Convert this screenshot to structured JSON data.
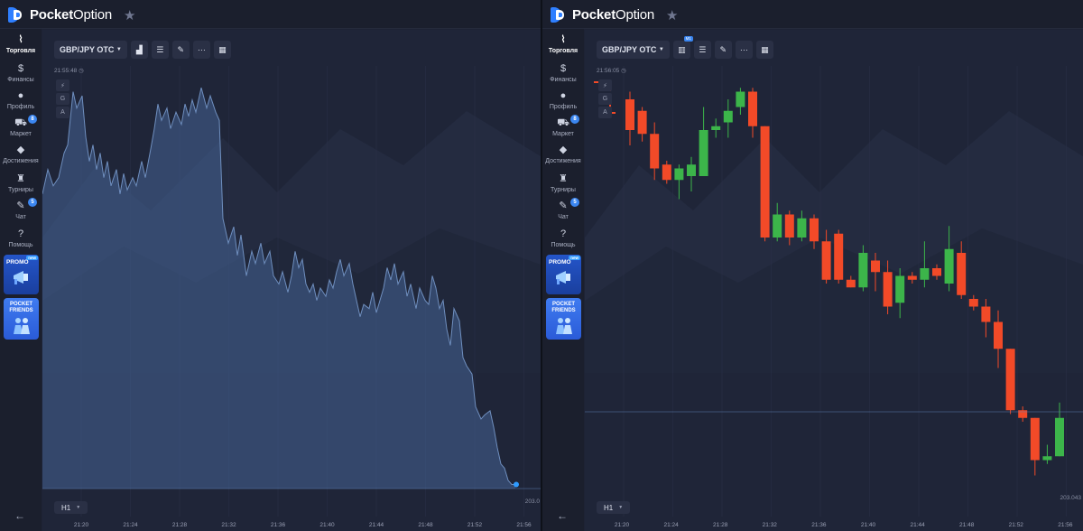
{
  "brand": {
    "name_bold": "Pocket",
    "name_light": "Option"
  },
  "sidebar": {
    "items": [
      {
        "label": "Торговля",
        "icon": "chart-line-icon",
        "glyph": "⌇",
        "active": true
      },
      {
        "label": "Финансы",
        "icon": "dollar-icon",
        "glyph": "$"
      },
      {
        "label": "Профиль",
        "icon": "user-icon",
        "glyph": "●"
      },
      {
        "label": "Маркет",
        "icon": "cart-icon",
        "glyph": "⛟",
        "badge": "8"
      },
      {
        "label": "Достижения",
        "icon": "diamond-icon",
        "glyph": "◆"
      },
      {
        "label": "Турниры",
        "icon": "trophy-icon",
        "glyph": "♜"
      },
      {
        "label": "Чат",
        "icon": "chat-icon",
        "glyph": "✎",
        "badge": "5"
      },
      {
        "label": "Помощь",
        "icon": "help-icon",
        "glyph": "?"
      }
    ],
    "promo": {
      "label": "PROMO",
      "tag": "new"
    },
    "friends": {
      "line1": "POCKET",
      "line2": "FRIENDS"
    }
  },
  "left_panel": {
    "pair": "GBP/JPY OTC",
    "timeframe": "H1",
    "timestamp": "21:55:48",
    "price_right": "203.0",
    "x_ticks": [
      "21:20",
      "21:24",
      "21:28",
      "21:32",
      "21:36",
      "21:40",
      "21:44",
      "21:48",
      "21:52",
      "21:56"
    ]
  },
  "right_panel": {
    "pair": "GBP/JPY OTC",
    "timeframe": "H1",
    "timestamp": "21:56:05",
    "price_label": "203.043",
    "x_ticks": [
      "21:20",
      "21:24",
      "21:28",
      "21:32",
      "21:36",
      "21:40",
      "21:44",
      "21:48",
      "21:52",
      "21:56"
    ],
    "indicator_badge": "M1"
  },
  "drawtools": [
    "G",
    "A"
  ],
  "colors": {
    "up": "#3cb54a",
    "down": "#f24a28",
    "accent": "#2f7fff",
    "area": "#3b5a86"
  },
  "chart_data": [
    {
      "type": "area",
      "title": "GBP/JPY OTC",
      "x": [
        "21:20",
        "21:24",
        "21:28",
        "21:32",
        "21:36",
        "21:40",
        "21:44",
        "21:48",
        "21:52",
        "21:56"
      ],
      "series": [
        {
          "values": [
            0.72,
            0.66,
            0.78,
            0.7,
            0.44,
            0.42,
            0.43,
            0.4,
            0.27,
            0.02
          ]
        }
      ]
    },
    {
      "type": "candlestick",
      "title": "GBP/JPY OTC",
      "candles": [
        {
          "o": 0.96,
          "c": 0.88,
          "h": 0.98,
          "l": 0.84
        },
        {
          "o": 0.93,
          "c": 0.87,
          "h": 0.94,
          "l": 0.85
        },
        {
          "o": 0.87,
          "c": 0.78,
          "h": 0.9,
          "l": 0.75
        },
        {
          "o": 0.79,
          "c": 0.75,
          "h": 0.8,
          "l": 0.74
        },
        {
          "o": 0.75,
          "c": 0.78,
          "h": 0.79,
          "l": 0.7
        },
        {
          "o": 0.76,
          "c": 0.79,
          "h": 0.81,
          "l": 0.72
        },
        {
          "o": 0.76,
          "c": 0.88,
          "h": 0.94,
          "l": 0.76
        },
        {
          "o": 0.88,
          "c": 0.89,
          "h": 0.91,
          "l": 0.86
        },
        {
          "o": 0.9,
          "c": 0.93,
          "h": 0.96,
          "l": 0.86
        },
        {
          "o": 0.94,
          "c": 0.98,
          "h": 0.99,
          "l": 0.92
        },
        {
          "o": 0.98,
          "c": 0.89,
          "h": 0.99,
          "l": 0.86
        },
        {
          "o": 0.89,
          "c": 0.6,
          "h": 0.89,
          "l": 0.59
        },
        {
          "o": 0.6,
          "c": 0.66,
          "h": 0.69,
          "l": 0.59
        },
        {
          "o": 0.66,
          "c": 0.6,
          "h": 0.67,
          "l": 0.58
        },
        {
          "o": 0.6,
          "c": 0.65,
          "h": 0.67,
          "l": 0.59
        },
        {
          "o": 0.65,
          "c": 0.59,
          "h": 0.66,
          "l": 0.57
        },
        {
          "o": 0.59,
          "c": 0.49,
          "h": 0.62,
          "l": 0.48
        },
        {
          "o": 0.61,
          "c": 0.49,
          "h": 0.62,
          "l": 0.48
        },
        {
          "o": 0.49,
          "c": 0.47,
          "h": 0.5,
          "l": 0.47
        },
        {
          "o": 0.47,
          "c": 0.56,
          "h": 0.58,
          "l": 0.46
        },
        {
          "o": 0.54,
          "c": 0.51,
          "h": 0.56,
          "l": 0.46
        },
        {
          "o": 0.51,
          "c": 0.42,
          "h": 0.54,
          "l": 0.4
        },
        {
          "o": 0.43,
          "c": 0.5,
          "h": 0.52,
          "l": 0.39
        },
        {
          "o": 0.5,
          "c": 0.49,
          "h": 0.51,
          "l": 0.48
        },
        {
          "o": 0.49,
          "c": 0.52,
          "h": 0.59,
          "l": 0.47
        },
        {
          "o": 0.52,
          "c": 0.5,
          "h": 0.53,
          "l": 0.49
        },
        {
          "o": 0.48,
          "c": 0.57,
          "h": 0.63,
          "l": 0.46
        },
        {
          "o": 0.56,
          "c": 0.45,
          "h": 0.59,
          "l": 0.44
        },
        {
          "o": 0.44,
          "c": 0.42,
          "h": 0.45,
          "l": 0.41
        },
        {
          "o": 0.42,
          "c": 0.38,
          "h": 0.44,
          "l": 0.34
        },
        {
          "o": 0.38,
          "c": 0.31,
          "h": 0.41,
          "l": 0.26
        },
        {
          "o": 0.31,
          "c": 0.15,
          "h": 0.31,
          "l": 0.14
        },
        {
          "o": 0.15,
          "c": 0.13,
          "h": 0.16,
          "l": 0.12
        },
        {
          "o": 0.13,
          "c": 0.02,
          "h": 0.13,
          "l": -0.02
        },
        {
          "o": 0.02,
          "c": 0.03,
          "h": 0.06,
          "l": 0.01
        },
        {
          "o": 0.03,
          "c": 0.13,
          "h": 0.17,
          "l": 0.03
        }
      ]
    }
  ]
}
